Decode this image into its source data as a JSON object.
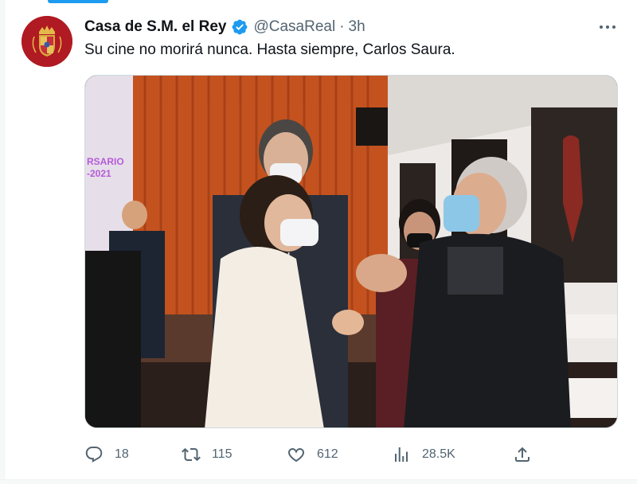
{
  "tweet": {
    "author": {
      "display_name": "Casa de S.M. el Rey",
      "handle": "@CasaReal",
      "verified": true
    },
    "separator": "·",
    "timestamp": "3h",
    "text": "Su cine no morirá nunca. Hasta siempre, Carlos Saura.",
    "media": {
      "banner_line1": "RSARIO",
      "banner_line2": "-2021"
    },
    "stats": {
      "replies": "18",
      "retweets": "115",
      "likes": "612",
      "views": "28.5K"
    }
  },
  "icons": {
    "avatar": "royal-crest-icon",
    "verified": "verified-badge-icon",
    "more": "more-dots-icon",
    "reply": "reply-icon",
    "retweet": "retweet-icon",
    "like": "heart-icon",
    "views": "views-bar-chart-icon",
    "share": "share-upload-icon"
  },
  "colors": {
    "accent": "#1d9bf0",
    "text_primary": "#0f1419",
    "text_secondary": "#536471",
    "avatar_background": "#b01a22"
  }
}
